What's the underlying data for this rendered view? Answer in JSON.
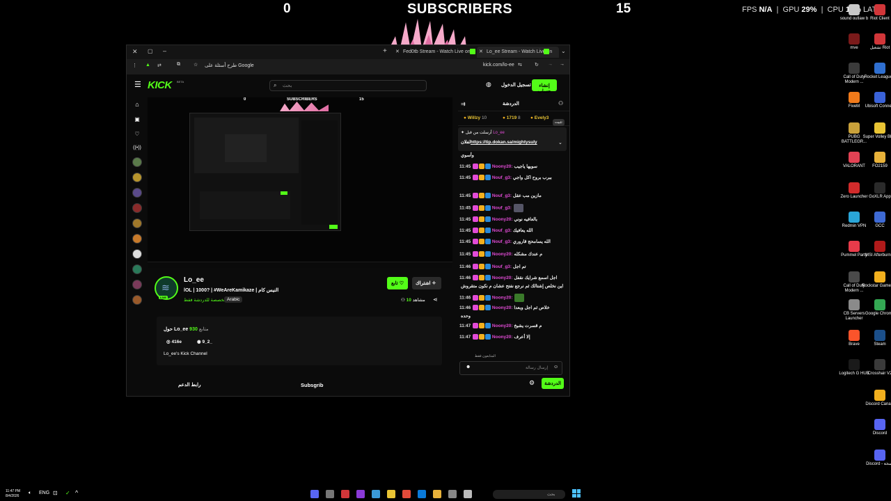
{
  "overlay": {
    "left_count": "0",
    "title": "SUBSCRIBERS",
    "right_count": "15"
  },
  "perf": {
    "fps_label": "FPS",
    "fps_value": "N/A",
    "gpu_label": "GPU",
    "gpu_value": "29",
    "gpu_unit": "%",
    "cpu_label": "CPU",
    "cpu_value": "16",
    "cpu_unit": "%",
    "lat_label": "LAT"
  },
  "desktop_icons": [
    {
      "label": "sound outlaw b",
      "color": "#c8c8c8"
    },
    {
      "label": "Riot Client",
      "color": "#d13639"
    },
    {
      "label": "mve",
      "color": "#7a1a1a"
    },
    {
      "label": "تشغيل Riot",
      "color": "#d13639"
    },
    {
      "label": "Call of Duty Modern ...",
      "color": "#3b3b3b"
    },
    {
      "label": "Rocket League®",
      "color": "#2f6fd0"
    },
    {
      "label": "FiveM",
      "color": "#f07a1a"
    },
    {
      "label": "Ubisoft Connect",
      "color": "#3a62d8"
    },
    {
      "label": "PUBG BATTLEGR...",
      "color": "#c9a13a"
    },
    {
      "label": "Super Volley Blast",
      "color": "#e9c434"
    },
    {
      "label": "VALORANT",
      "color": "#e24254"
    },
    {
      "label": "FO2159",
      "color": "#e8b23a"
    },
    {
      "label": "Zero Launcher",
      "color": "#d12b2b"
    },
    {
      "label": "GoXLR App",
      "color": "#2a2a2a"
    },
    {
      "label": "Redmin VPN",
      "color": "#2aa6d8"
    },
    {
      "label": "GCC",
      "color": "#3e6ad4"
    },
    {
      "label": "Pummel Party",
      "color": "#e83b4a"
    },
    {
      "label": "MSI Afterburner",
      "color": "#b01a1a"
    },
    {
      "label": "Call of Duty Modern ...",
      "color": "#4a4a4a"
    },
    {
      "label": "Rockstar Games ...",
      "color": "#f2b01e"
    },
    {
      "label": "CB Servers Launcher",
      "color": "#8a8a8a"
    },
    {
      "label": "Google Chrome",
      "color": "#34a853"
    },
    {
      "label": "Brave",
      "color": "#fb542b"
    },
    {
      "label": "Steam",
      "color": "#1b4f8a"
    },
    {
      "label": "Logitech G HUB",
      "color": "#1a1a1a"
    },
    {
      "label": "Crosshair V2",
      "color": "#3a3a3a"
    },
    {
      "label": "Discord Canary",
      "color": "#f2b01e"
    },
    {
      "label": "Discord",
      "color": "#5865f2"
    },
    {
      "label": "Discord - نسخة",
      "color": "#5865f2"
    }
  ],
  "browser": {
    "tabs": [
      {
        "title": "Fed0tb Stream - Watch Live on",
        "icon": "kick-icon"
      },
      {
        "title": "Lo_ee Stream - Watch Live on",
        "icon": "kick-icon"
      }
    ],
    "google_button": "طرح أسئلة على Google",
    "url": "kick.com/lo-ee"
  },
  "kick": {
    "logo": "KICK",
    "logo_badge": "BETA",
    "search_placeholder": "بحث",
    "login": "تسجيل الدخول",
    "signup": "إنشاء حساب"
  },
  "video_overlay": {
    "left_count": "0",
    "title": "SUBSCRIBERS",
    "right_count": "15"
  },
  "channel": {
    "name": "Lo_ee",
    "live_badge": "LIVE",
    "title": "lOL | 1000? | #WeAreKamikaze | النيس كام",
    "category": "مخصصة للدردشة فقط",
    "language": "Arabic",
    "follow": "تابع",
    "subscribe": "اشتراك",
    "viewers_count": "10",
    "viewers_label": "مشاهد"
  },
  "about": {
    "followers_count": "930",
    "followers_label": "متابع",
    "about_prefix": "حول",
    "about_name": "Lo_ee",
    "instagram": "416e",
    "discord": "9_2_",
    "description": "Lo_ee's Kick Channel"
  },
  "panels": {
    "support_link": "رابط الدعم",
    "subsgrib": "Subsgrib"
  },
  "chat": {
    "title": "الدردشة",
    "gifters": [
      {
        "name": "Willzy",
        "count": "10"
      },
      {
        "name": "1719",
        "count": "8"
      },
      {
        "name": "Evely3",
        "count": ""
      }
    ],
    "pinned_label": "أرسلت من قبل",
    "pinned_user": "Lo_ee",
    "pinned_link": "https://tip.dokan.sa/mightysuly",
    "pinned_suffix": "لفلان",
    "tooltip": "تثبيت",
    "messages": [
      {
        "time": "",
        "user": "",
        "color": "#e24bd6",
        "text": "وأسوي"
      },
      {
        "time": "11:45",
        "user": "Noony20:",
        "color": "#e24bd6",
        "text": "سويها ياجيب"
      },
      {
        "time": "11:45",
        "user": "Nouf_g3:",
        "color": "#e24bd6",
        "text": "ببرب بروح اكل واجي"
      },
      {
        "time": "11:45",
        "user": "Nouf_g3:",
        "color": "#e24bd6",
        "text": "مازين مب عقل"
      },
      {
        "time": "11:45",
        "user": "Nouf_g3:",
        "color": "#e24bd6",
        "text": ""
      },
      {
        "time": "11:45",
        "user": "Noony20:",
        "color": "#e24bd6",
        "text": "بالعافيه نوني"
      },
      {
        "time": "11:45",
        "user": "Nouf_g3:",
        "color": "#e24bd6",
        "text": "الله يعافيك"
      },
      {
        "time": "11:45",
        "user": "Nouf_g3:",
        "color": "#e24bd6",
        "text": "الله يسامحج قاروري"
      },
      {
        "time": "11:45",
        "user": "Noony20:",
        "color": "#e24bd6",
        "text": "م عندك مشكله"
      },
      {
        "time": "11:46",
        "user": "Nouf_g3:",
        "color": "#e24bd6",
        "text": "تم اجل"
      },
      {
        "time": "11:46",
        "user": "Noony20:",
        "color": "#e24bd6",
        "text": "اجل اسمع شرايك نقفل"
      },
      {
        "time": "",
        "user": "",
        "color": "#e24bd6",
        "text": "اين نخلص إشتالك ثم نرجع نفتح عشان م نكون متقروش"
      },
      {
        "time": "11:46",
        "user": "Noony20:",
        "color": "#e24bd6",
        "text": ""
      },
      {
        "time": "11:46",
        "user": "Noony20:",
        "color": "#e24bd6",
        "text": "خلاص ثم اجل وبعدا"
      },
      {
        "time": "",
        "user": "",
        "color": "#e24bd6",
        "text": "وحده"
      },
      {
        "time": "11:47",
        "user": "Noony20:",
        "color": "#e24bd6",
        "text": "م قسرت يشيخ"
      },
      {
        "time": "11:47",
        "user": "Noony20:",
        "color": "#e24bd6",
        "text": "إلا أعرف"
      }
    ],
    "followers_only": "المتابعون فقط",
    "input_placeholder": "إرسال رسالة",
    "send_button": "الدردشة"
  },
  "taskbar": {
    "time": "11:47 PM",
    "date": "8/4/2026",
    "lang": "ENG",
    "search_placeholder": "بحث"
  },
  "colors": {
    "kick_green": "#53fc18",
    "chat_user": "#e24bd6",
    "bg": "#000000"
  }
}
